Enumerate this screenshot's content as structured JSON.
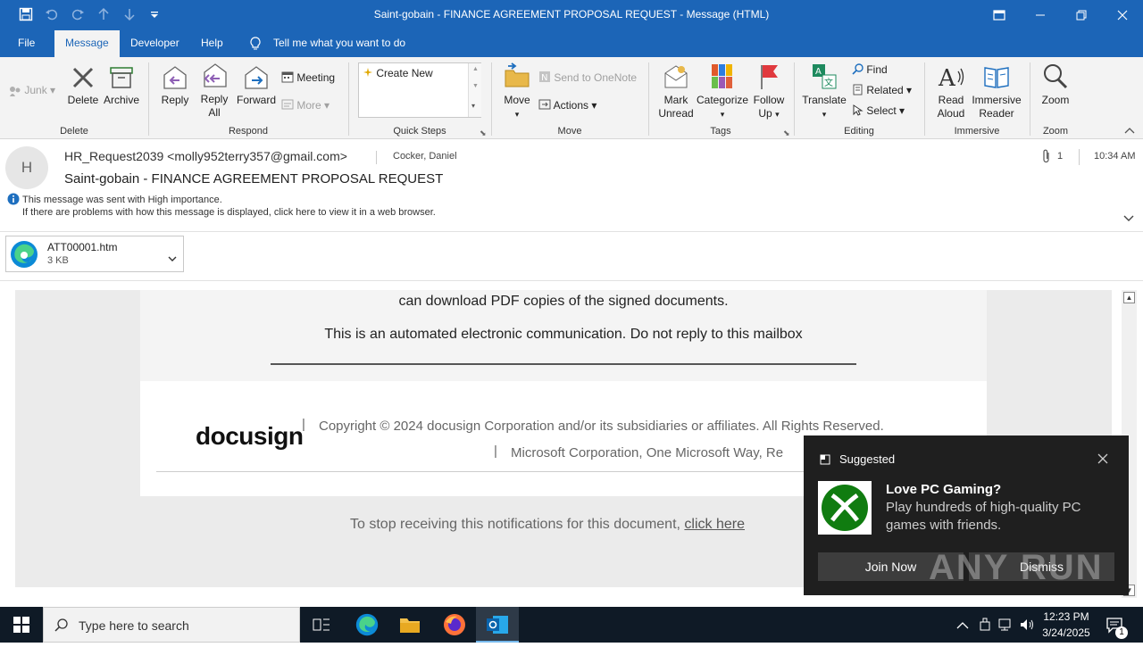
{
  "window": {
    "title": "Saint-gobain - FINANCE AGREEMENT PROPOSAL REQUEST  -  Message (HTML)"
  },
  "tabs": [
    "File",
    "Message",
    "Developer",
    "Help"
  ],
  "tell_me": "Tell me what you want to do",
  "ribbon": {
    "junk": "Junk",
    "delete": "Delete",
    "archive": "Archive",
    "group_delete": "Delete",
    "reply": "Reply",
    "reply_all_1": "Reply",
    "reply_all_2": "All",
    "forward": "Forward",
    "meeting": "Meeting",
    "more": "More",
    "group_respond": "Respond",
    "create_new": "Create New",
    "group_quicksteps": "Quick Steps",
    "move": "Move",
    "send_onenote": "Send to OneNote",
    "actions": "Actions",
    "group_move": "Move",
    "mark_unread_1": "Mark",
    "mark_unread_2": "Unread",
    "categorize": "Categorize",
    "follow_up_1": "Follow",
    "follow_up_2": "Up",
    "group_tags": "Tags",
    "translate": "Translate",
    "find": "Find",
    "related": "Related",
    "select": "Select",
    "group_editing": "Editing",
    "read_aloud_1": "Read",
    "read_aloud_2": "Aloud",
    "immersive_1": "Immersive",
    "immersive_2": "Reader",
    "group_immersive": "Immersive",
    "zoom": "Zoom",
    "group_zoom": "Zoom"
  },
  "message": {
    "avatar_initial": "H",
    "from": "HR_Request2039 <molly952terry357@gmail.com>",
    "to": "Cocker, Daniel",
    "attachment_count": "1",
    "time": "10:34 AM",
    "subject": "Saint-gobain - FINANCE AGREEMENT PROPOSAL REQUEST",
    "importance": "This message was sent with High importance.",
    "display_problem": "If there are problems with how this message is displayed, click here to view it in a web browser."
  },
  "attachment": {
    "name": "ATT00001.htm",
    "size": "3 KB"
  },
  "body": {
    "line1": "can download PDF copies of the signed documents.",
    "line2": "This is an automated electronic communication. Do not reply to this mailbox",
    "logo": "docusign",
    "copyright": "Copyright © 2024 docusign Corporation and/or its subsidiaries or affiliates. All Rights Reserved.",
    "address": "Microsoft Corporation, One Microsoft Way, Re",
    "unsubscribe_text": "To stop receiving this notifications for this document,",
    "unsubscribe_link": "click here"
  },
  "toast": {
    "header": "Suggested",
    "title": "Love PC Gaming?",
    "text_1": "Play hundreds of high-quality PC",
    "text_2": "games with friends.",
    "join": "Join Now",
    "dismiss": "Dismiss",
    "watermark": "ANY RUN"
  },
  "taskbar": {
    "search_placeholder": "Type here to search",
    "time": "12:23 PM",
    "date": "3/24/2025",
    "notification_count": "1"
  }
}
